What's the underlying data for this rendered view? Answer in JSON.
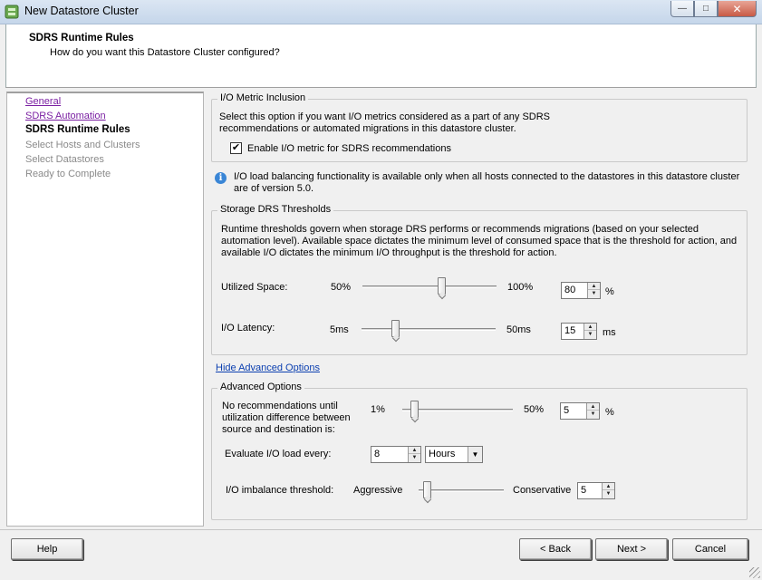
{
  "window": {
    "title": "New Datastore Cluster"
  },
  "header": {
    "title": "SDRS Runtime Rules",
    "subtitle": "How do you want this Datastore Cluster configured?"
  },
  "nav": {
    "items": [
      {
        "label": "General",
        "state": "link"
      },
      {
        "label": "SDRS Automation",
        "state": "link"
      },
      {
        "label": "SDRS Runtime Rules",
        "state": "current"
      },
      {
        "label": "Select Hosts and Clusters",
        "state": "disabled"
      },
      {
        "label": "Select Datastores",
        "state": "disabled"
      },
      {
        "label": "Ready to Complete",
        "state": "disabled"
      }
    ]
  },
  "io_metric": {
    "legend": "I/O Metric Inclusion",
    "description_line1": "Select this option if you want I/O metrics considered as a part of any SDRS",
    "description_line2": "recommendations or automated migrations in this datastore cluster.",
    "checkbox_label": "Enable I/O metric for SDRS recommendations",
    "checked": true
  },
  "info": {
    "line1": "I/O load balancing functionality is available only when all hosts connected to the datastores in this datastore cluster",
    "line2": "are of version 5.0."
  },
  "thresholds": {
    "legend": "Storage DRS Thresholds",
    "description_line1": "Runtime thresholds govern when storage DRS performs or recommends migrations (based on your selected",
    "description_line2": "automation level). Available space dictates the minimum level of consumed space that is the threshold for action, and",
    "description_line3": "available I/O dictates the minimum I/O throughput is the threshold for action.",
    "utilized_space": {
      "label": "Utilized Space:",
      "min": "50%",
      "max": "100%",
      "value": "80",
      "unit": "%",
      "slider_fraction": 0.6
    },
    "io_latency": {
      "label": "I/O Latency:",
      "min": "5ms",
      "max": "50ms",
      "value": "15",
      "unit": "ms",
      "slider_fraction": 0.24
    }
  },
  "advanced_toggle": {
    "label": "Hide Advanced Options"
  },
  "advanced": {
    "legend": "Advanced Options",
    "no_rec_line1": "No recommendations until",
    "no_rec_line2": "utilization difference between",
    "no_rec_line3": "source and destination is:",
    "no_rec": {
      "min": "1%",
      "max": "50%",
      "value": "5",
      "unit": "%",
      "slider_fraction": 0.08
    },
    "evaluate": {
      "label": "Evaluate I/O load every:",
      "value": "8",
      "unit_selected": "Hours"
    },
    "imbalance": {
      "label": "I/O imbalance threshold:",
      "min": "Aggressive",
      "max": "Conservative",
      "value": "5",
      "slider_fraction": 0.06
    }
  },
  "footer": {
    "help": "Help",
    "back": "< Back",
    "next": "Next >",
    "cancel": "Cancel"
  }
}
